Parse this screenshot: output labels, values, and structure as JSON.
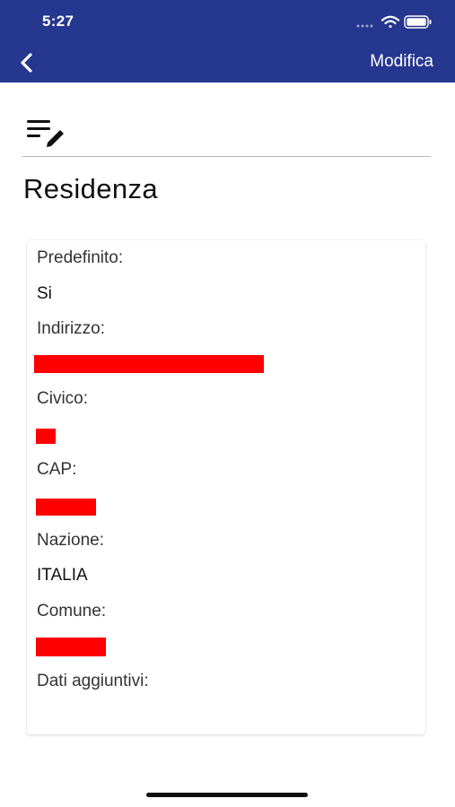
{
  "status_bar": {
    "time": "5:27"
  },
  "nav": {
    "edit_label": "Modifica",
    "back_icon": "chevron-left-icon"
  },
  "colors": {
    "header_bg": "#26378f",
    "redaction": "#ff0000",
    "card_bg": "#ffffff"
  },
  "page": {
    "title": "Residenza"
  },
  "details": {
    "predefinito_label": "Predefinito:",
    "predefinito_value": "Si",
    "indirizzo_label": "Indirizzo:",
    "civico_label": "Civico:",
    "cap_label": "CAP:",
    "nazione_label": "Nazione:",
    "nazione_value": "ITALIA",
    "comune_label": "Comune:",
    "dati_label": "Dati aggiuntivi:"
  }
}
